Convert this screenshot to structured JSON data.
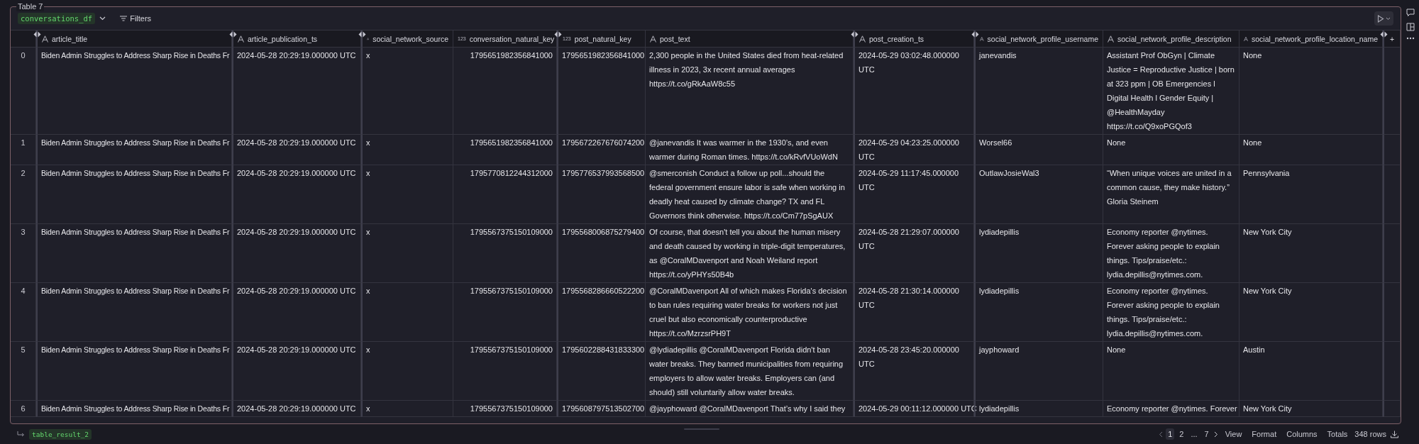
{
  "cell_title": "Table 7",
  "toolbar": {
    "dataframe": "conversations_df",
    "filters": "Filters"
  },
  "table": {
    "columns": [
      {
        "name": "article_title",
        "kind": "string",
        "resized": true
      },
      {
        "name": "article_publication_ts",
        "kind": "string",
        "resized": true
      },
      {
        "name": "social_network_source",
        "kind": "string",
        "resized": true
      },
      {
        "name": "conversation_natural_key",
        "kind": "number",
        "type_label": "123",
        "resized": false
      },
      {
        "name": "post_natural_key",
        "kind": "number",
        "type_label": "123",
        "resized": true
      },
      {
        "name": "post_text",
        "kind": "string",
        "resized": false
      },
      {
        "name": "post_creation_ts",
        "kind": "string",
        "resized": true
      },
      {
        "name": "social_network_profile_username",
        "kind": "string",
        "resized": true
      },
      {
        "name": "social_network_profile_description",
        "kind": "string",
        "resized": false
      },
      {
        "name": "social_network_profile_location_name",
        "kind": "string",
        "resized": false
      }
    ],
    "add_column": {
      "label": "+",
      "resized": true
    },
    "rows": [
      {
        "index": "0",
        "cells": [
          "Biden Admin Struggles to Address Sharp Rise in Deaths Fr",
          "2024-05-28 20:29:19.000000 UTC",
          "x",
          "1795651982356841000",
          "1795651982356841000",
          "2,300 people in the United States died from heat-related illness in 2023, 3x recent annual averages https://t.co/gRkAaW8c55",
          "2024-05-29 03:02:48.000000 UTC",
          "janevandis",
          "Assistant Prof ObGyn | Climate Justice = Reproductive Justice | born at 323 ppm | OB Emergencies l Digital Health l Gender Equity | @HealthMayday https://t.co/Q9xoPGQof3",
          "None"
        ]
      },
      {
        "index": "1",
        "cells": [
          "Biden Admin Struggles to Address Sharp Rise in Deaths Fr",
          "2024-05-28 20:29:19.000000 UTC",
          "x",
          "1795651982356841000",
          "1795672267676074200",
          "@janevandis It was warmer in the 1930’s, and even warmer during Roman times. https://t.co/kRvfVUoWdN",
          "2024-05-29 04:23:25.000000 UTC",
          "Worsel66",
          "None",
          "None"
        ]
      },
      {
        "index": "2",
        "cells": [
          "Biden Admin Struggles to Address Sharp Rise in Deaths Fr",
          "2024-05-28 20:29:19.000000 UTC",
          "x",
          "1795770812244312000",
          "1795776537993568500",
          "@smerconish Conduct a follow up poll...should the federal government ensure labor is safe when working in deadly heat caused by climate change? TX and FL Governors think otherwise. https://t.co/Cm77pSgAUX",
          "2024-05-29 11:17:45.000000 UTC",
          "OutlawJosieWal3",
          "“When unique voices are united in a common cause, they make history.” Gloria Steinem",
          "Pennsylvania"
        ]
      },
      {
        "index": "3",
        "cells": [
          "Biden Admin Struggles to Address Sharp Rise in Deaths Fr",
          "2024-05-28 20:29:19.000000 UTC",
          "x",
          "1795567375150109000",
          "1795568006875279400",
          "Of course, that doesn't tell you about the human misery and death caused by working in triple-digit temperatures, as @CoralMDavenport and Noah Weiland report https://t.co/yPHYs50B4b",
          "2024-05-28 21:29:07.000000 UTC",
          "lydiadepillis",
          "Economy reporter @nytimes. Forever asking people to explain things. Tips/praise/etc.: lydia.depillis@nytimes.com.",
          "New York City"
        ]
      },
      {
        "index": "4",
        "cells": [
          "Biden Admin Struggles to Address Sharp Rise in Deaths Fr",
          "2024-05-28 20:29:19.000000 UTC",
          "x",
          "1795567375150109000",
          "1795568286660522200",
          "@CoralMDavenport All of which makes Florida's decision to ban rules requiring water breaks for workers not just cruel but also economically counterproductive https://t.co/MzrzsrPH9T",
          "2024-05-28 21:30:14.000000 UTC",
          "lydiadepillis",
          "Economy reporter @nytimes. Forever asking people to explain things. Tips/praise/etc.: lydia.depillis@nytimes.com.",
          "New York City"
        ]
      },
      {
        "index": "5",
        "cells": [
          "Biden Admin Struggles to Address Sharp Rise in Deaths Fr",
          "2024-05-28 20:29:19.000000 UTC",
          "x",
          "1795567375150109000",
          "1795602288431833300",
          "@lydiadepillis @CoralMDavenport Florida didn't ban water breaks. They banned municipalities from requiring employers to allow water breaks. Employers can (and should) still voluntarily allow water breaks.",
          "2024-05-28 23:45:20.000000 UTC",
          "jayphoward",
          "None",
          "Austin"
        ]
      },
      {
        "index": "6",
        "cells": [
          "Biden Admin Struggles to Address Sharp Rise in Deaths Fr",
          "2024-05-28 20:29:19.000000 UTC",
          "x",
          "1795567375150109000",
          "1795608797513502700",
          "@jayphoward @CoralMDavenport That’s why I said they",
          "2024-05-29 00:11:12.000000 UTC",
          "lydiadepillis",
          "Economy reporter @nytimes. Forever",
          "New York City"
        ]
      }
    ]
  },
  "footer": {
    "result": "table_result_2",
    "pages": [
      {
        "label": "1",
        "selected": true
      },
      {
        "label": "2",
        "selected": false
      },
      {
        "label": "...",
        "selected": false
      },
      {
        "label": "7",
        "selected": false
      }
    ],
    "actions": [
      "View",
      "Format",
      "Columns",
      "Totals"
    ],
    "row_count": "348 rows"
  }
}
